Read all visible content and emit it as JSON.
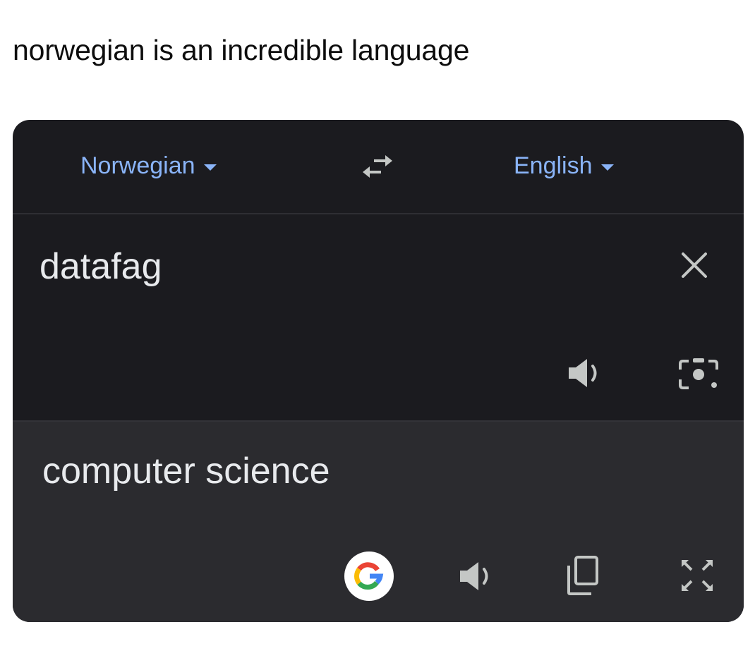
{
  "caption": "norwegian is an incredible language",
  "translator": {
    "source_language": "Norwegian",
    "target_language": "English",
    "source_text": "datafag",
    "translated_text": "computer science",
    "icons": {
      "swap": "swap-arrows-icon",
      "clear": "close-icon",
      "listen": "speaker-icon",
      "camera": "camera-lens-icon",
      "google": "google-g-icon",
      "copy": "copy-icon",
      "fullscreen": "fullscreen-icon"
    },
    "colors": {
      "accent": "#8ab4f8",
      "source_bg": "#1b1b1f",
      "target_bg": "#2b2b2f",
      "text": "#e8eaed",
      "icon": "#c4c7c5"
    }
  }
}
